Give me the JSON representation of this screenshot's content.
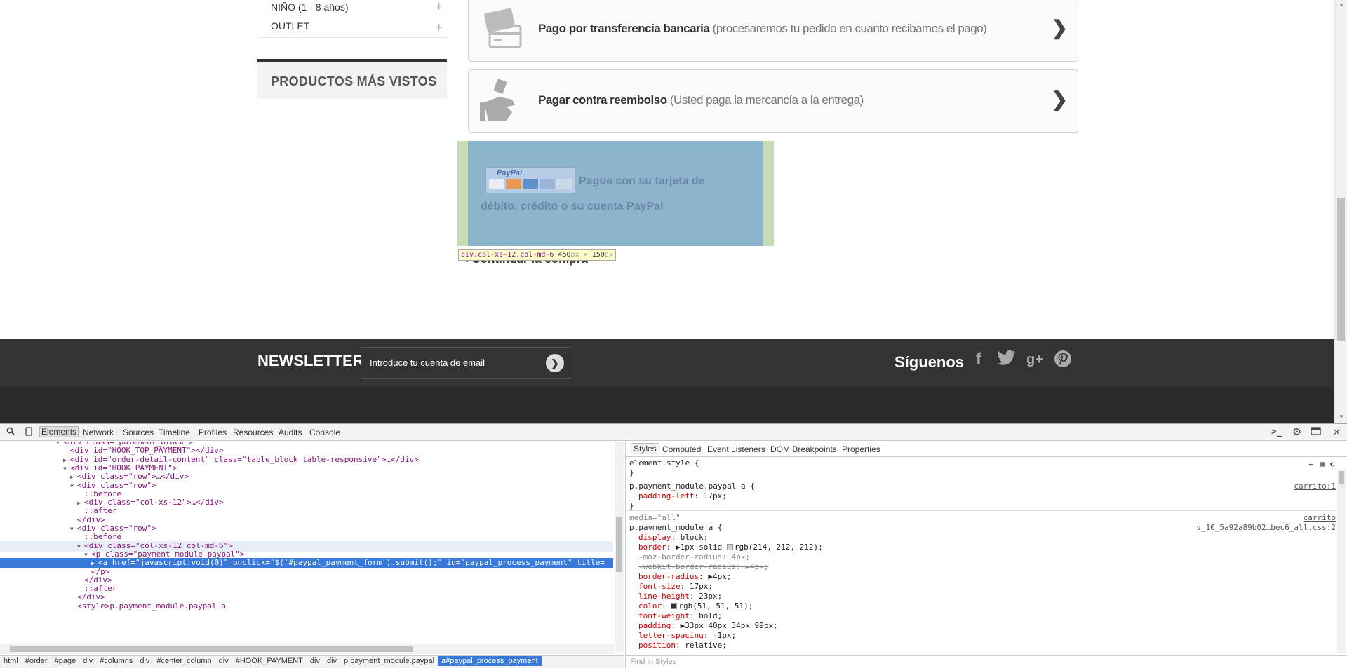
{
  "sidebar": {
    "categories": [
      {
        "label": "NIÑO (1 - 8 años)",
        "expand": "+"
      },
      {
        "label": "OUTLET",
        "expand": "+"
      }
    ],
    "most_viewed_title": "PRODUCTOS MÁS VISTOS"
  },
  "payment": {
    "bank_transfer": {
      "title": "Pago por transferencia bancaria",
      "subtitle": "(procesaremos tu pedido en cuanto recibamos el pago)"
    },
    "cash_on_delivery": {
      "title": "Pagar contra reembolso",
      "subtitle": "(Usted paga la mercancía a la entrega)"
    },
    "paypal": {
      "logo_text": "PayPal",
      "text": "Pague con su tarjeta de débito, crédito o su cuenta PayPal"
    },
    "continue_label": "Continuar la compra"
  },
  "inspector_tooltip": {
    "selector": "div.col-xs-12.col-md-6",
    "width": "450",
    "height": "150",
    "unit": "px",
    "times": "×"
  },
  "footer": {
    "newsletter_title": "NEWSLETTER",
    "newsletter_placeholder": "Introduce tu cuenta de email",
    "follow_title": "Síguenos",
    "social_icons": [
      "facebook-icon",
      "twitter-icon",
      "google-plus-icon",
      "pinterest-icon"
    ]
  },
  "devtools": {
    "tabs": [
      "Elements",
      "Network",
      "Sources",
      "Timeline",
      "Profiles",
      "Resources",
      "Audits",
      "Console"
    ],
    "active_tab": "Elements",
    "dom_lines": [
      {
        "indent": 7,
        "tri": "▼",
        "html": "<div class=\"paiement_block\">"
      },
      {
        "indent": 8,
        "tri": "",
        "html": "<div id=\"HOOK_TOP_PAYMENT\"></div>"
      },
      {
        "indent": 8,
        "tri": "▶",
        "html": "<div id=\"order-detail-content\" class=\"table_block table-responsive\">…</div>"
      },
      {
        "indent": 8,
        "tri": "▼",
        "html": "<div id=\"HOOK_PAYMENT\">"
      },
      {
        "indent": 9,
        "tri": "▶",
        "html": "<div class=\"row\">…</div>"
      },
      {
        "indent": 9,
        "tri": "▼",
        "html": "<div class=\"row\">"
      },
      {
        "indent": 10,
        "tri": "",
        "html": "::before"
      },
      {
        "indent": 10,
        "tri": "▶",
        "html": "<div class=\"col-xs-12\">…</div>"
      },
      {
        "indent": 10,
        "tri": "",
        "html": "::after"
      },
      {
        "indent": 9,
        "tri": "",
        "html": "</div>"
      },
      {
        "indent": 9,
        "tri": "▼",
        "html": "<div class=\"row\">"
      },
      {
        "indent": 10,
        "tri": "",
        "html": "::before"
      },
      {
        "indent": 10,
        "tri": "▼",
        "html": "<div class=\"col-xs-12 col-md-6\">"
      },
      {
        "indent": 11,
        "tri": "▼",
        "html": "<p class=\"payment_module paypal\">"
      },
      {
        "indent": 12,
        "tri": "▶",
        "html": "<a href=\"javascript:void(0)\" onclick=\"$('#paypal_payment_form').submit();\" id=\"paypal_process_payment\" title="
      },
      {
        "indent": 11,
        "tri": "",
        "html": "</p>"
      },
      {
        "indent": 10,
        "tri": "",
        "html": "</div>"
      },
      {
        "indent": 10,
        "tri": "",
        "html": "::after"
      },
      {
        "indent": 9,
        "tri": "",
        "html": "</div>"
      },
      {
        "indent": 9,
        "tri": "",
        "html": "<style>p.payment_module.paypal a"
      }
    ],
    "selected_line": 14,
    "hover_line": 12,
    "breadcrumbs": [
      "html",
      "#order",
      "#page",
      "div",
      "#columns",
      "div",
      "#center_column",
      "div",
      "#HOOK_PAYMENT",
      "div",
      "div",
      "p.payment_module.paypal",
      "a#paypal_process_payment"
    ],
    "styles_tabs": [
      "Styles",
      "Computed",
      "Event Listeners",
      "DOM Breakpoints",
      "Properties"
    ],
    "element_style": {
      "selector": "element.style {",
      "close": "}"
    },
    "rule1": {
      "selector": "p.payment_module.paypal a {",
      "source": "carrito:1",
      "decls": [
        {
          "prop": "padding-left",
          "val": "17px;"
        }
      ],
      "close": "}"
    },
    "rule2": {
      "media": "media=\"all\"",
      "media_source": "carrito",
      "selector": "p.payment_module a {",
      "source": "v_10_5a92a89b02…bec6_all.css:2",
      "decls": [
        {
          "prop": "display",
          "val": "block;",
          "strike": false,
          "swatch": ""
        },
        {
          "prop": "border",
          "val": "▶1px solid ",
          "strike": false,
          "swatch": "#d6d4d4",
          "after": "rgb(214, 212, 212);"
        },
        {
          "prop": "-moz-border-radius",
          "val": "4px;",
          "strike": true,
          "swatch": ""
        },
        {
          "prop": "-webkit-border-radius",
          "val": "▶4px;",
          "strike": true,
          "swatch": ""
        },
        {
          "prop": "border-radius",
          "val": "▶4px;",
          "strike": false,
          "swatch": ""
        },
        {
          "prop": "font-size",
          "val": "17px;",
          "strike": false,
          "swatch": ""
        },
        {
          "prop": "line-height",
          "val": "23px;",
          "strike": false,
          "swatch": ""
        },
        {
          "prop": "color",
          "val": "",
          "strike": false,
          "swatch": "#333333",
          "after": "rgb(51, 51, 51);"
        },
        {
          "prop": "font-weight",
          "val": "bold;",
          "strike": false,
          "swatch": ""
        },
        {
          "prop": "padding",
          "val": "▶33px 40px 34px 99px;",
          "strike": false,
          "swatch": ""
        },
        {
          "prop": "letter-spacing",
          "val": "-1px;",
          "strike": false,
          "swatch": ""
        },
        {
          "prop": "position",
          "val": "relative;",
          "strike": false,
          "swatch": ""
        }
      ]
    },
    "find_placeholder": "Find in Styles"
  }
}
